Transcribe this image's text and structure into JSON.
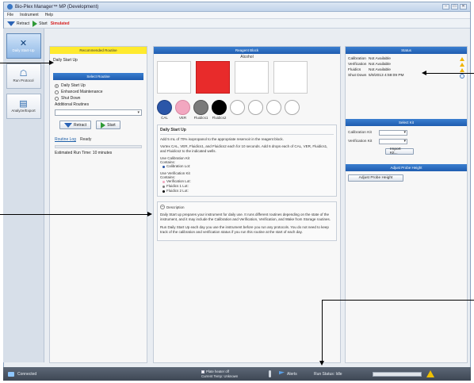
{
  "window": {
    "title": "Bio-Plex Manager™ MP (Development)",
    "controls": [
      "–",
      "▭",
      "✕"
    ]
  },
  "menu": [
    "File",
    "Instrument",
    "Help"
  ],
  "toolbar": {
    "retract_label": "Retract",
    "start_label": "Start",
    "mode_label": "Simulated"
  },
  "nav": [
    {
      "label": "Daily Start-Up",
      "icon": "wrench-screwdriver-icon",
      "active": true
    },
    {
      "label": "Run Protocol",
      "icon": "runner-icon",
      "active": false
    },
    {
      "label": "Analyze/Export",
      "icon": "chart-icon",
      "active": false
    }
  ],
  "routines": {
    "recommended_header": "Recommended Routine",
    "recommended_text": "Daily Start Up",
    "select_header": "Select Routine",
    "options": [
      {
        "label": "Daily Start Up",
        "selected": true
      },
      {
        "label": "Enhanced Maintenance",
        "selected": false
      },
      {
        "label": "Shut Down",
        "selected": false
      }
    ],
    "additional_label": "Additional Routines",
    "additional_value": "",
    "retract_btn": "Retract",
    "start_btn": "Start",
    "log_link": "Routine Log",
    "log_status": "Ready",
    "est_run_time": "Estimated Run Time: 10 minutes"
  },
  "reagent": {
    "header": "Reagent Block",
    "alcohol_label": "Alcohol",
    "circle_labels": [
      "CAL",
      "VER",
      "Fluidics1",
      "Fluidics2"
    ],
    "info_title": "Daily Start Up",
    "info_p1": "Add 5 mL of 70% isopropanol to the appropriate reservoir in the reagent block.",
    "info_p2": "Vortex CAL, VER, Fluidics1, and Fluidics2 each for 10 seconds. Add 6 drops each of CAL, VER, Fluidics1, and Fluidics2 to the indicated wells.",
    "cal_kit_label": "Use Calibration Kit",
    "cal_kit_contains": "Contains:",
    "cal_kit_items": [
      "Calibration Lot:"
    ],
    "ver_kit_label": "Use Verification Kit",
    "ver_kit_contains": "Contains:",
    "ver_kit_items": [
      "Verification Lot:",
      "Fluidics 1 Lot:",
      "Fluidics 2 Lot:"
    ],
    "desc_title": "Description",
    "desc_p1": "Daily Start up prepares your instrument for daily use. It runs different routines depending on the state of the instrument, and it may include the Calibration and Verification, Verification, and Wake from Storage routines.",
    "desc_p2": "Run Daily Start Up each day you use the instrument before you run any protocols. You do not need to keep track of the calibration and verification status if you run this routine at the start of each day."
  },
  "status": {
    "header": "Status",
    "rows": [
      {
        "key": "Calibration",
        "value": "Not Available",
        "icon": "warning-icon"
      },
      {
        "key": "Verification",
        "value": "Not Available",
        "icon": "warning-icon"
      },
      {
        "key": "Fluidics",
        "value": "Not Available",
        "icon": "warning-icon"
      },
      {
        "key": "Shut Down",
        "value": "5/9/2013 4:59:09 PM",
        "icon": "clock-icon"
      }
    ],
    "select_kit_header": "Select Kit",
    "calibration_kit_label": "Calibration Kit",
    "verification_kit_label": "Verification Kit",
    "import_btn": "Import Kit...",
    "adjust_header": "Adjust Probe Height",
    "adjust_btn": "Adjust Probe Height"
  },
  "statusbar": {
    "connection": "Connected",
    "plate_heater": "Plate heater off",
    "current_temp": "Current Temp: Unknown",
    "alerts": "Alerts",
    "run_status": "Run Status: Idle"
  },
  "colors": {
    "accent_blue": "#1f5db0",
    "recommended_yellow": "#ffea2e",
    "alcohol_red": "#e82b2b",
    "ver_pink": "#f2a7c0",
    "cal_blue": "#2b56a8",
    "fluidics1_gray": "#7a7a7a",
    "fluidics2_black": "#000000",
    "simulated_red": "#d62020",
    "warning_yellow": "#f0b400"
  }
}
